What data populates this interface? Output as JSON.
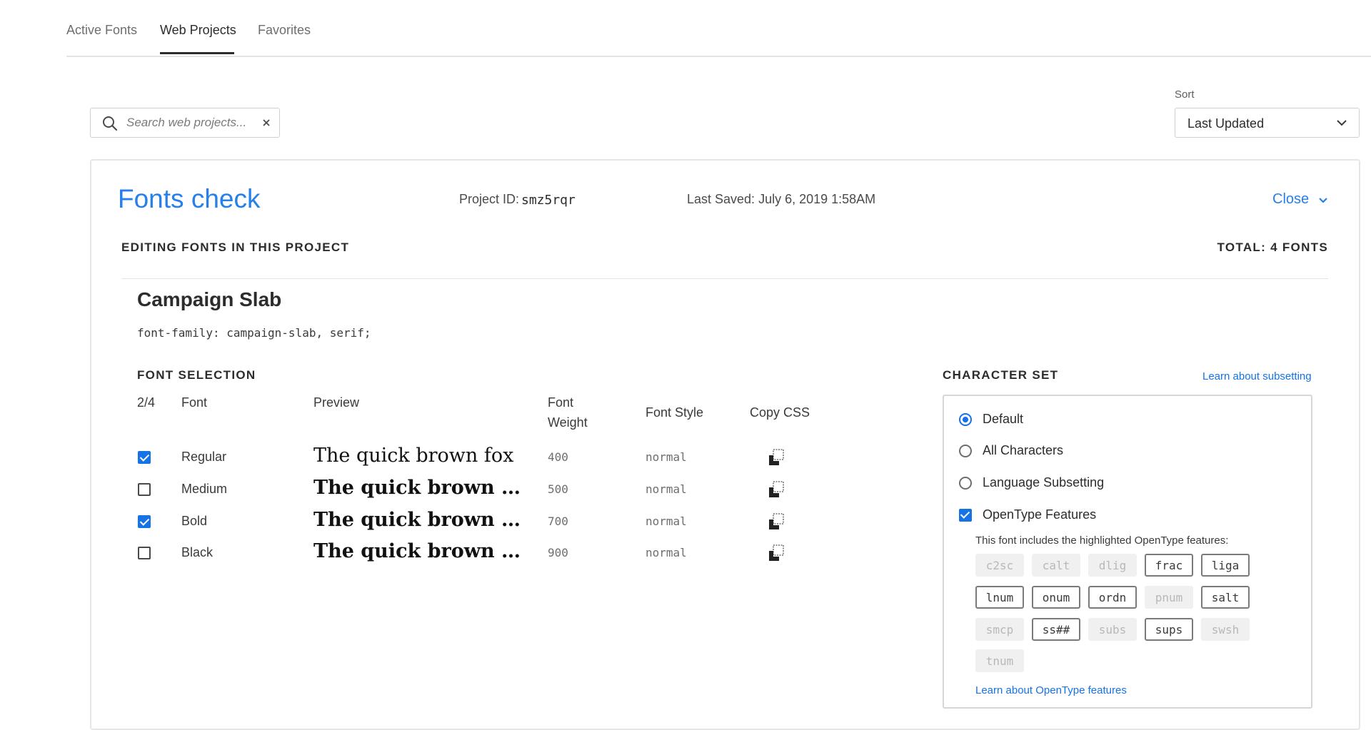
{
  "tabs": [
    {
      "label": "Active Fonts",
      "active": false
    },
    {
      "label": "Web Projects",
      "active": true
    },
    {
      "label": "Favorites",
      "active": false
    }
  ],
  "search": {
    "placeholder": "Search web projects...",
    "value": ""
  },
  "sort": {
    "label": "Sort",
    "value": "Last Updated"
  },
  "project": {
    "title": "Fonts check",
    "id_label": "Project ID:",
    "id": "smz5rqr",
    "last_saved": "Last Saved: July 6, 2019 1:58AM",
    "close_label": "Close",
    "editing_heading": "EDITING FONTS IN THIS PROJECT",
    "total": "TOTAL: 4 FONTS"
  },
  "family": {
    "name": "Campaign Slab",
    "css": "font-family: campaign-slab, serif;"
  },
  "font_selection": {
    "heading": "FONT SELECTION",
    "count": "2/4",
    "col_font": "Font",
    "col_preview": "Preview",
    "col_weight_1": "Font",
    "col_weight_2": "Weight",
    "col_style": "Font Style",
    "col_copy": "Copy CSS",
    "rows": [
      {
        "name": "Regular",
        "checked": true,
        "preview": "The quick brown fox",
        "weight": "400",
        "style": "normal"
      },
      {
        "name": "Medium",
        "checked": false,
        "preview": "The quick brown fox",
        "weight": "500",
        "style": "normal"
      },
      {
        "name": "Bold",
        "checked": true,
        "preview": "The quick brown fox",
        "weight": "700",
        "style": "normal"
      },
      {
        "name": "Black",
        "checked": false,
        "preview": "The quick brown fox",
        "weight": "900",
        "style": "normal"
      }
    ]
  },
  "character_set": {
    "heading": "CHARACTER SET",
    "learn_link": "Learn about subsetting",
    "options": [
      {
        "label": "Default",
        "selected": true
      },
      {
        "label": "All Characters",
        "selected": false
      },
      {
        "label": "Language Subsetting",
        "selected": false
      }
    ],
    "opentype_label": "OpenType Features",
    "opentype_checked": true,
    "feature_note": "This font includes the highlighted OpenType features:",
    "features": [
      {
        "tag": "c2sc",
        "on": false
      },
      {
        "tag": "calt",
        "on": false
      },
      {
        "tag": "dlig",
        "on": false
      },
      {
        "tag": "frac",
        "on": true
      },
      {
        "tag": "liga",
        "on": true
      },
      {
        "tag": "lnum",
        "on": true
      },
      {
        "tag": "onum",
        "on": true
      },
      {
        "tag": "ordn",
        "on": true
      },
      {
        "tag": "pnum",
        "on": false
      },
      {
        "tag": "salt",
        "on": true
      },
      {
        "tag": "smcp",
        "on": false
      },
      {
        "tag": "ss##",
        "on": true
      },
      {
        "tag": "subs",
        "on": false
      },
      {
        "tag": "sups",
        "on": true
      },
      {
        "tag": "swsh",
        "on": false
      },
      {
        "tag": "tnum",
        "on": false
      }
    ],
    "opentype_learn_link": "Learn about OpenType features"
  },
  "colors": {
    "accent": "#1473e6",
    "title_blue": "#2680eb"
  },
  "icons": {
    "search": "search-icon",
    "clear": "close-icon",
    "dropdown": "chevron-down-icon",
    "copy": "copy-icon"
  }
}
